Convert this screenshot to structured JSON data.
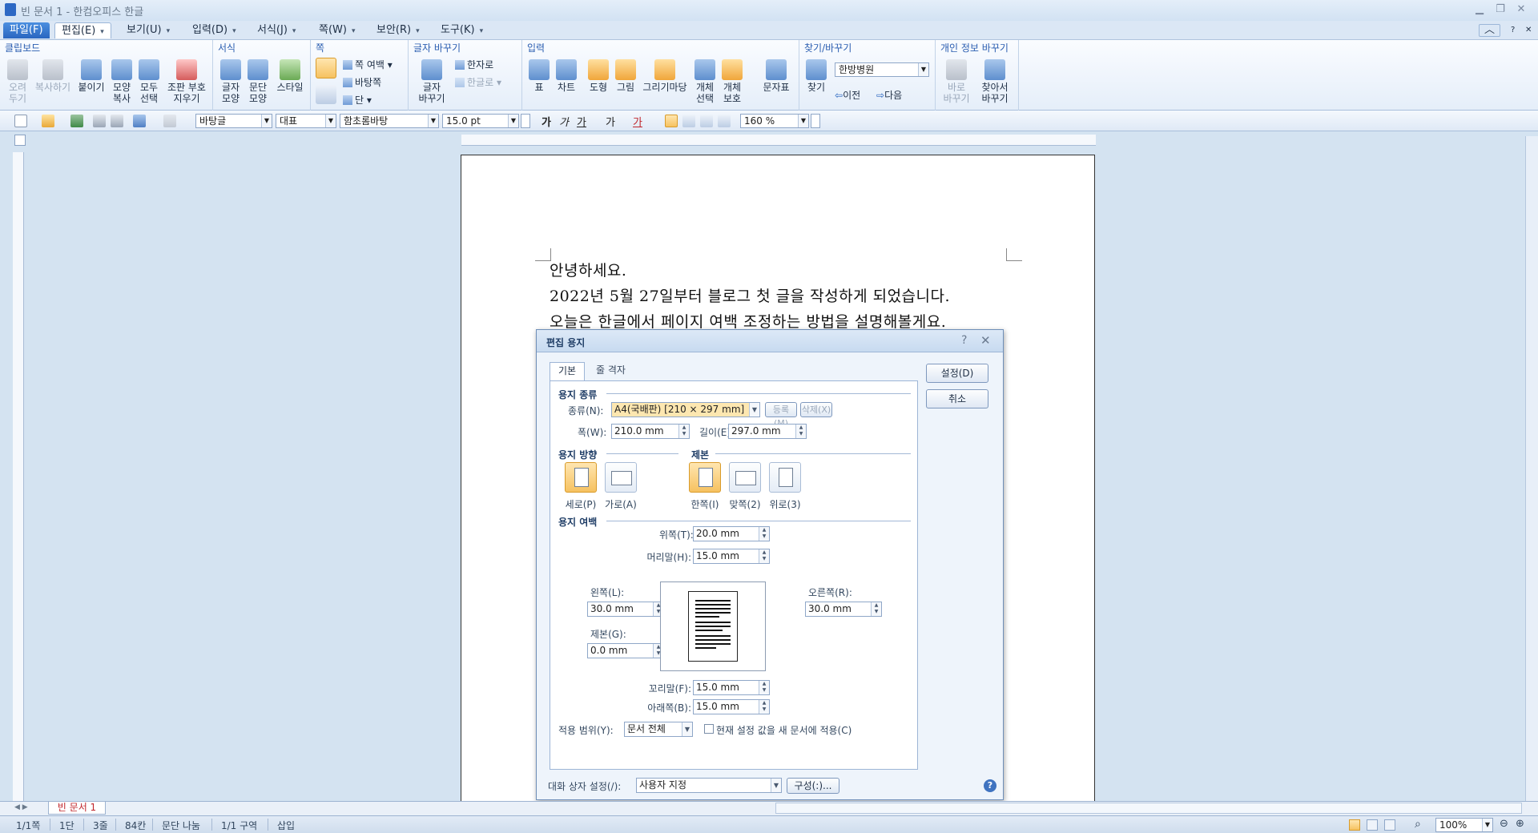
{
  "window": {
    "title": "빈 문서 1 - 한컴오피스 한글",
    "minimize": "▁",
    "restore": "❐",
    "close": "✕",
    "ribbon_min": "︿"
  },
  "menu": [
    {
      "label": "파일(F)"
    },
    {
      "label": "편집(E)"
    },
    {
      "label": "보기(U)"
    },
    {
      "label": "입력(D)"
    },
    {
      "label": "서식(J)"
    },
    {
      "label": "쪽(W)"
    },
    {
      "label": "보안(R)"
    },
    {
      "label": "도구(K)"
    }
  ],
  "ribbon": {
    "clipboard": {
      "label": "클립보드",
      "cut": "오려\n두기",
      "copy": "복사하기",
      "paste": "붙이기",
      "format_copy": "모양\n복사",
      "select_all": "모두\n선택",
      "clear_marks": "조판 부호\n지우기"
    },
    "format": {
      "label": "서식",
      "char_shape": "글자\n모양",
      "para_shape": "문단\n모양",
      "style": "스타일"
    },
    "page": {
      "label": "쪽",
      "margin": "쪽 여백",
      "background": "바탕쪽",
      "columns": "단"
    },
    "convert": {
      "label": "글자 바꾸기",
      "char_convert": "글자\n바꾸기",
      "to_hanja": "한자로",
      "to_hangul": "한글로"
    },
    "insert": {
      "label": "입력",
      "table": "표",
      "chart": "차트",
      "shape": "도형",
      "picture": "그림",
      "gallery": "그리기마당",
      "obj_select": "개체\n선택",
      "obj_protect": "개체\n보호",
      "symbol": "문자표"
    },
    "find": {
      "label": "찾기/바꾸기",
      "find": "찾기",
      "search_value": "한방병원",
      "prev": "이전",
      "next": "다음"
    },
    "privacy": {
      "label": "개인 정보 바꾸기",
      "replace_now": "바로\n바꾸기",
      "find_replace": "찾아서\n바꾸기"
    }
  },
  "toolbar": {
    "style": "바탕글",
    "outline": "대표",
    "font": "함초롬바탕",
    "font_size": "15.0",
    "size_unit": "pt",
    "bold": "가",
    "italic": "가",
    "underline": "가",
    "strike": "가",
    "color": "가",
    "line_spacing": "160",
    "spacing_unit": "%"
  },
  "document": {
    "lines": [
      "안녕하세요.",
      "2022년 5월 27일부터 블로그 첫 글을 작성하게 되었습니다.",
      "오늘은 한글에서 페이지 여백 조정하는 방법을 설명해볼게요."
    ]
  },
  "dialog": {
    "title": "편집 용지",
    "help": "?",
    "close": "✕",
    "tabs": [
      "기본",
      "줄 격자"
    ],
    "paper_section": "용지 종류",
    "paper_type_label": "종류(N):",
    "paper_type_value": "A4(국배판) [210 × 297 mm]",
    "register_btn": "등록(M)",
    "delete_btn": "삭제(X)",
    "width_label": "폭(W):",
    "width_value": "210.0 mm",
    "height_label": "길이(E):",
    "height_value": "297.0 mm",
    "orientation_section": "용지 방향",
    "portrait": "세로(P)",
    "landscape": "가로(A)",
    "binding_section": "제본",
    "bind_single": "한쪽(I)",
    "bind_facing": "맞쪽(2)",
    "bind_top": "위로(3)",
    "margin_section": "용지 여백",
    "top_label": "위쪽(T):",
    "top_value": "20.0 mm",
    "header_label": "머리말(H):",
    "header_value": "15.0 mm",
    "left_label": "왼쪽(L):",
    "left_value": "30.0 mm",
    "right_label": "오른쪽(R):",
    "right_value": "30.0 mm",
    "gutter_label": "제본(G):",
    "gutter_value": "0.0 mm",
    "footer_label": "꼬리말(F):",
    "footer_value": "15.0 mm",
    "bottom_label": "아래쪽(B):",
    "bottom_value": "15.0 mm",
    "apply_label": "적용 범위(Y):",
    "apply_value": "문서 전체",
    "apply_new_doc": "현재 설정 값을 새 문서에 적용(C)",
    "settings_label": "대화 상자 설정(/):",
    "settings_value": "사용자 지정",
    "compose_btn": "구성(:)...",
    "ok_btn": "설정(D)",
    "cancel_btn": "취소"
  },
  "tabs": {
    "sheet": "빈 문서 1"
  },
  "status": {
    "page": "1/1쪽",
    "column": "1단",
    "line": "3줄",
    "col_pos": "84칸",
    "section_break": "문단 나눔",
    "section": "1/1 구역",
    "mode": "삽입",
    "zoom": "100%"
  },
  "colors": {
    "accent": "#2a66c0",
    "dialog_bg": "#eef4fb",
    "selected_orient": "#f6c260"
  }
}
